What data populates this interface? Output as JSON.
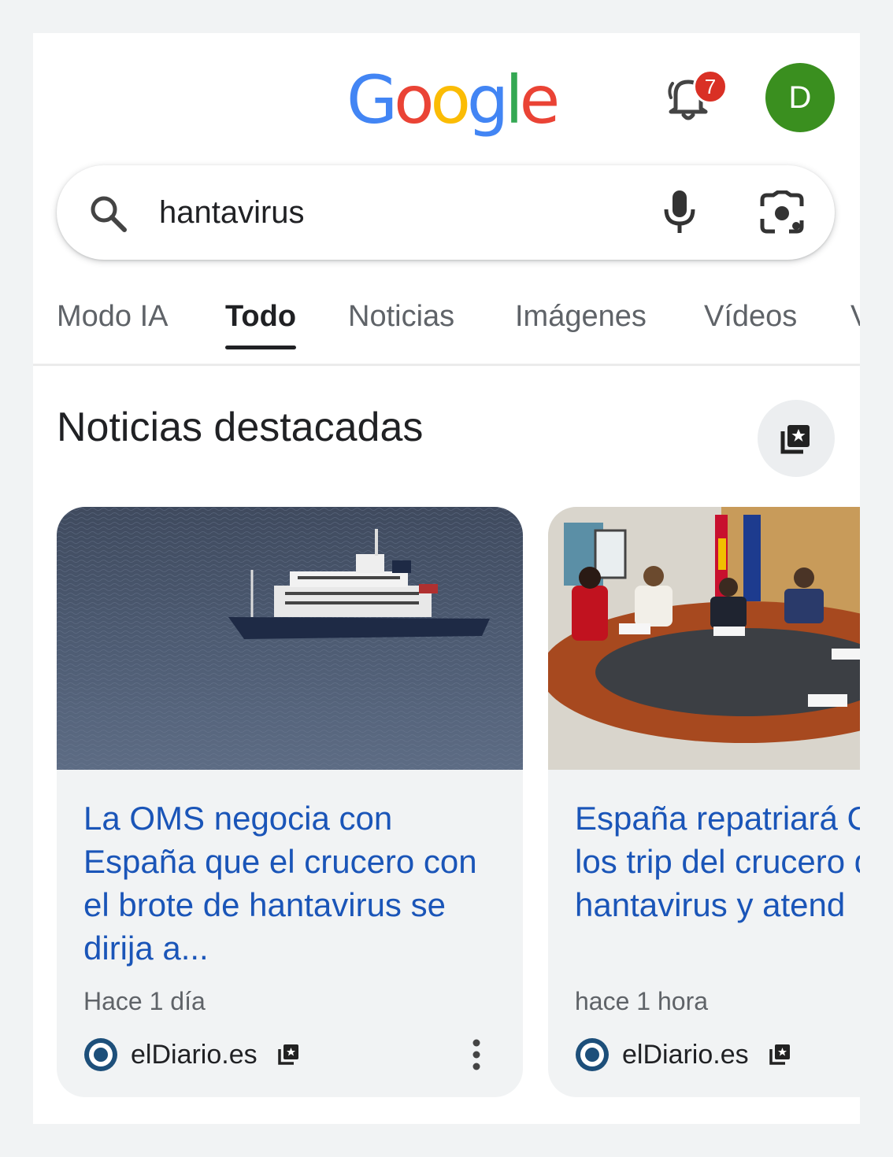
{
  "header": {
    "logo_letters": [
      "G",
      "o",
      "o",
      "g",
      "l",
      "e"
    ],
    "logo_colors": [
      "#4285F4",
      "#EA4335",
      "#FBBC05",
      "#4285F4",
      "#34A853",
      "#EA4335"
    ],
    "notification_count": "7",
    "avatar_initial": "D",
    "avatar_color": "#3a8f1f"
  },
  "search": {
    "query": "hantavirus",
    "icons": [
      "search-icon",
      "microphone-icon",
      "google-lens-icon"
    ]
  },
  "tabs": [
    {
      "label": "Modo IA",
      "active": false
    },
    {
      "label": "Todo",
      "active": true
    },
    {
      "label": "Noticias",
      "active": false
    },
    {
      "label": "Imágenes",
      "active": false
    },
    {
      "label": "Vídeos",
      "active": false
    },
    {
      "label": "V",
      "active": false
    }
  ],
  "top_stories": {
    "title": "Noticias destacadas",
    "action_icon": "news-showcase-icon",
    "cards": [
      {
        "image": "cruise-ship-photo",
        "headline": "La OMS negocia con España que el crucero con el brote de hantavirus se dirija a...",
        "time": "Hace 1 día",
        "source": "elDiario.es",
        "menu_icon": "more-vert-icon"
      },
      {
        "image": "meeting-room-photo",
        "headline": "España repatriará Canarias a los trip del crucero del hantavirus y atend",
        "time": "hace 1 hora",
        "source": "elDiario.es"
      }
    ]
  },
  "colors": {
    "link_blue": "#1a55b8",
    "page_bg": "#f1f3f4",
    "badge_red": "#d93025",
    "source_logo": "#1d4f7a"
  }
}
